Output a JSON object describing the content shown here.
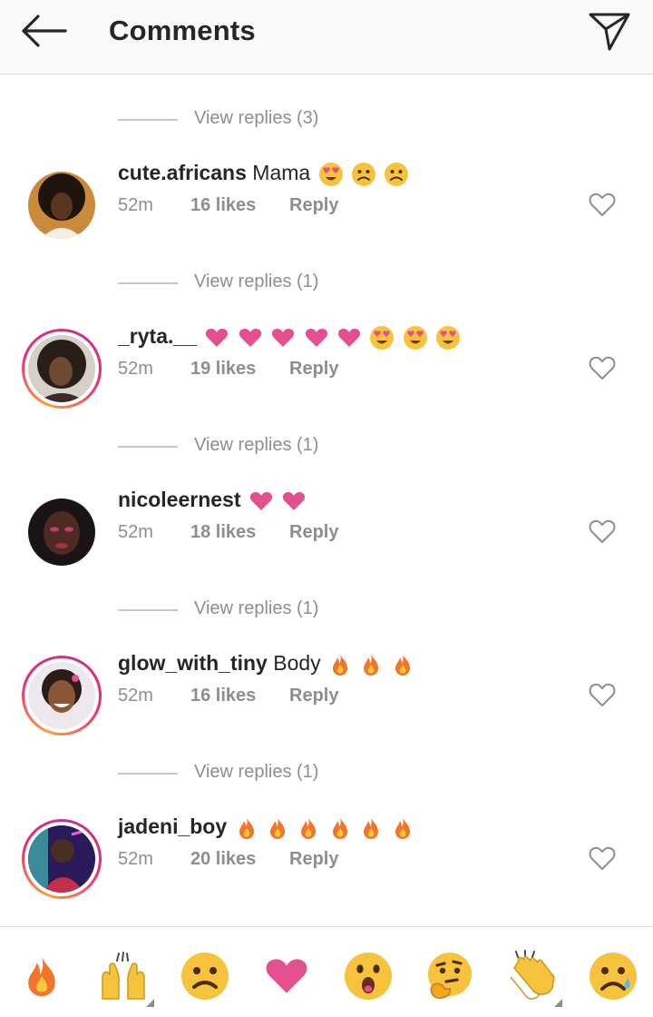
{
  "header": {
    "title": "Comments",
    "back_icon": "arrow-left-icon",
    "send_icon": "paper-plane-icon"
  },
  "comments": [
    {
      "view_replies": "View replies (3)",
      "username": "cute.africans",
      "text": "Mama",
      "emojis": [
        "heart-eyes",
        "frown",
        "frown"
      ],
      "time": "52m",
      "likes": "16 likes",
      "reply": "Reply",
      "story_ring": false
    },
    {
      "view_replies": "View replies (1)",
      "username": "_ryta.__",
      "text": "",
      "emojis": [
        "pink-heart",
        "pink-heart",
        "pink-heart",
        "pink-heart",
        "pink-heart",
        "heart-eyes",
        "heart-eyes",
        "heart-eyes"
      ],
      "time": "52m",
      "likes": "19 likes",
      "reply": "Reply",
      "story_ring": true
    },
    {
      "view_replies": "View replies (1)",
      "username": "nicoleernest",
      "text": "",
      "emojis": [
        "pink-heart",
        "pink-heart"
      ],
      "time": "52m",
      "likes": "18 likes",
      "reply": "Reply",
      "story_ring": false
    },
    {
      "view_replies": "View replies (1)",
      "username": "glow_with_tiny",
      "text": "Body",
      "emojis": [
        "fire",
        "fire",
        "fire"
      ],
      "time": "52m",
      "likes": "16 likes",
      "reply": "Reply",
      "story_ring": true
    },
    {
      "view_replies": "View replies (1)",
      "username": "jadeni_boy",
      "text": "",
      "emojis": [
        "fire",
        "fire",
        "fire",
        "fire",
        "fire",
        "fire"
      ],
      "time": "52m",
      "likes": "20 likes",
      "reply": "Reply",
      "story_ring": true
    }
  ],
  "emoji_bar": [
    "fire",
    "raised-hands",
    "frown",
    "pink-heart",
    "open-mouth",
    "thinking",
    "clapping",
    "sad-tear"
  ],
  "colors": {
    "text": "#262626",
    "secondary": "#8e8e8e",
    "divider": "#dbdbdb",
    "heart": "#e4508f",
    "story_ring_start": "#f9a13a",
    "story_ring_end": "#c13584"
  }
}
